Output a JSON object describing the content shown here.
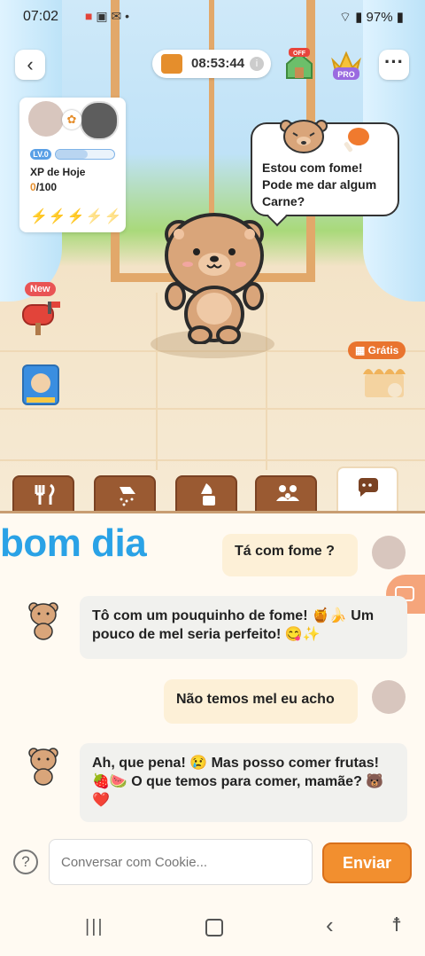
{
  "status_bar": {
    "time": "07:02",
    "notif_icons": [
      "video-icon",
      "photos-icon",
      "messenger-icon",
      "dot-icon"
    ],
    "battery": "97%"
  },
  "top_bar": {
    "timer": "08:53:44",
    "off_badge": "OFF",
    "pro_badge": "PRO"
  },
  "xp_card": {
    "level": "LV.0",
    "label": "XP de Hoje",
    "current": "0",
    "total": "/100",
    "energy_bolts": 5,
    "level_progress": 0.55
  },
  "pet_bubble": {
    "text": "Estou com fome! Pode me dar algum Carne?"
  },
  "side_items": {
    "new_label": "New",
    "free_label": "Grátis"
  },
  "tabs": [
    {
      "name": "food",
      "icon": "fork-knife-icon",
      "active": false
    },
    {
      "name": "shower",
      "icon": "shower-icon",
      "active": false
    },
    {
      "name": "toilet",
      "icon": "toilet-icon",
      "active": false
    },
    {
      "name": "family",
      "icon": "people-icon",
      "active": false
    },
    {
      "name": "chat",
      "icon": "chat-bubbles-icon",
      "active": true
    }
  ],
  "overlay_text": "bom dia",
  "messages": [
    {
      "from": "user",
      "text": "Tá com fome ?"
    },
    {
      "from": "pet",
      "text": "Tô com um pouquinho de fome! 🍯🍌 Um pouco de mel seria perfeito! 😋✨"
    },
    {
      "from": "user",
      "text": "Não temos mel eu acho"
    },
    {
      "from": "pet",
      "text": "Ah, que pena! 😢 Mas posso comer frutas! 🍓🍉 O que temos para comer, mamãe? 🐻❤️"
    }
  ],
  "input": {
    "placeholder": "Conversar com Cookie...",
    "send_label": "Enviar"
  },
  "colors": {
    "accent": "#f28f2f",
    "tab_brown": "#9a5a32",
    "overlay_blue": "#2aa2e6"
  }
}
